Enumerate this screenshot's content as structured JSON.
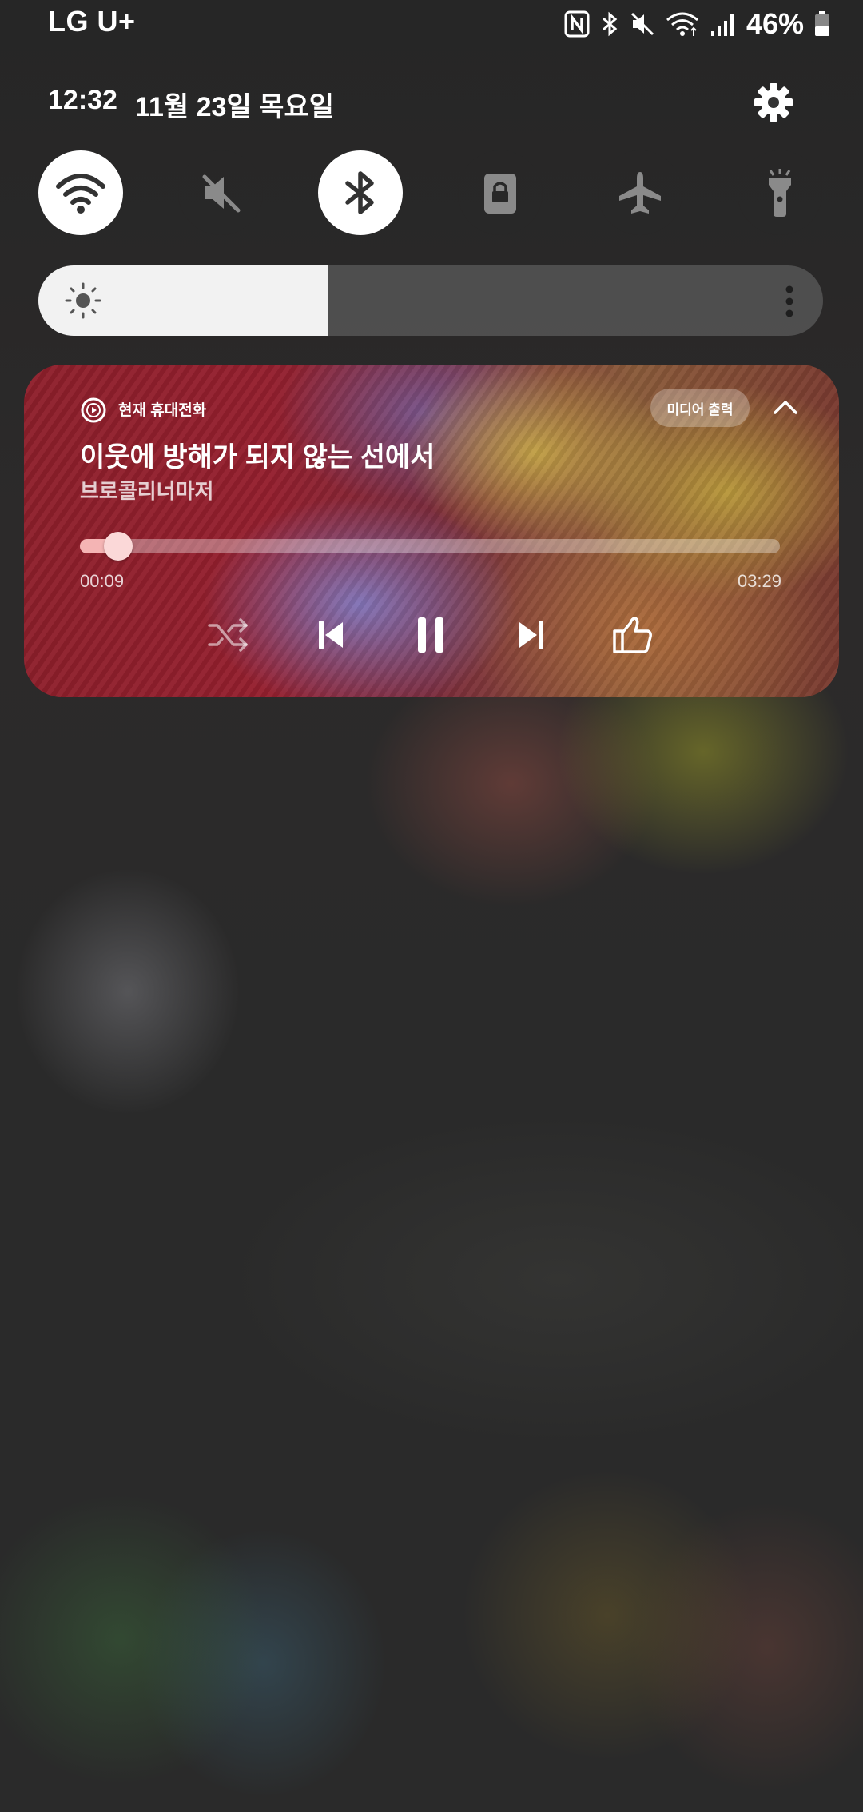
{
  "status_bar": {
    "carrier": "LG U+",
    "battery_percent": "46%",
    "battery_level": 0.46,
    "icons": [
      "nfc-icon",
      "bluetooth-icon",
      "mute-icon",
      "wifi-icon",
      "cellular-signal-icon",
      "battery-icon"
    ]
  },
  "header": {
    "time": "12:32",
    "date": "11월 23일 목요일",
    "settings_icon": "gear-icon"
  },
  "quick_tiles": [
    {
      "name": "wifi",
      "icon": "wifi-icon",
      "state": "on"
    },
    {
      "name": "sound",
      "icon": "mute-icon",
      "state": "off"
    },
    {
      "name": "bluetooth",
      "icon": "bluetooth-icon",
      "state": "on"
    },
    {
      "name": "screen-lock",
      "icon": "lock-icon",
      "state": "off"
    },
    {
      "name": "airplane",
      "icon": "airplane-icon",
      "state": "off"
    },
    {
      "name": "flashlight",
      "icon": "flashlight-icon",
      "state": "off"
    }
  ],
  "brightness": {
    "level": 0.37,
    "icon": "sun-icon",
    "more_icon": "more-vertical-icon"
  },
  "media": {
    "app_name": "현재 휴대전화",
    "output_label": "미디어 출력",
    "title": "이웃에 방해가 되지 않는 선에서",
    "artist": "브로콜리너마저",
    "elapsed": "00:09",
    "total": "03:29",
    "progress": 0.043,
    "controls": [
      "shuffle-icon",
      "previous-icon",
      "pause-icon",
      "next-icon",
      "thumbs-up-icon"
    ]
  },
  "colors": {
    "tile_on": "#ffffff",
    "tile_off": "#282828",
    "media_accent": "#f4b4b4"
  }
}
